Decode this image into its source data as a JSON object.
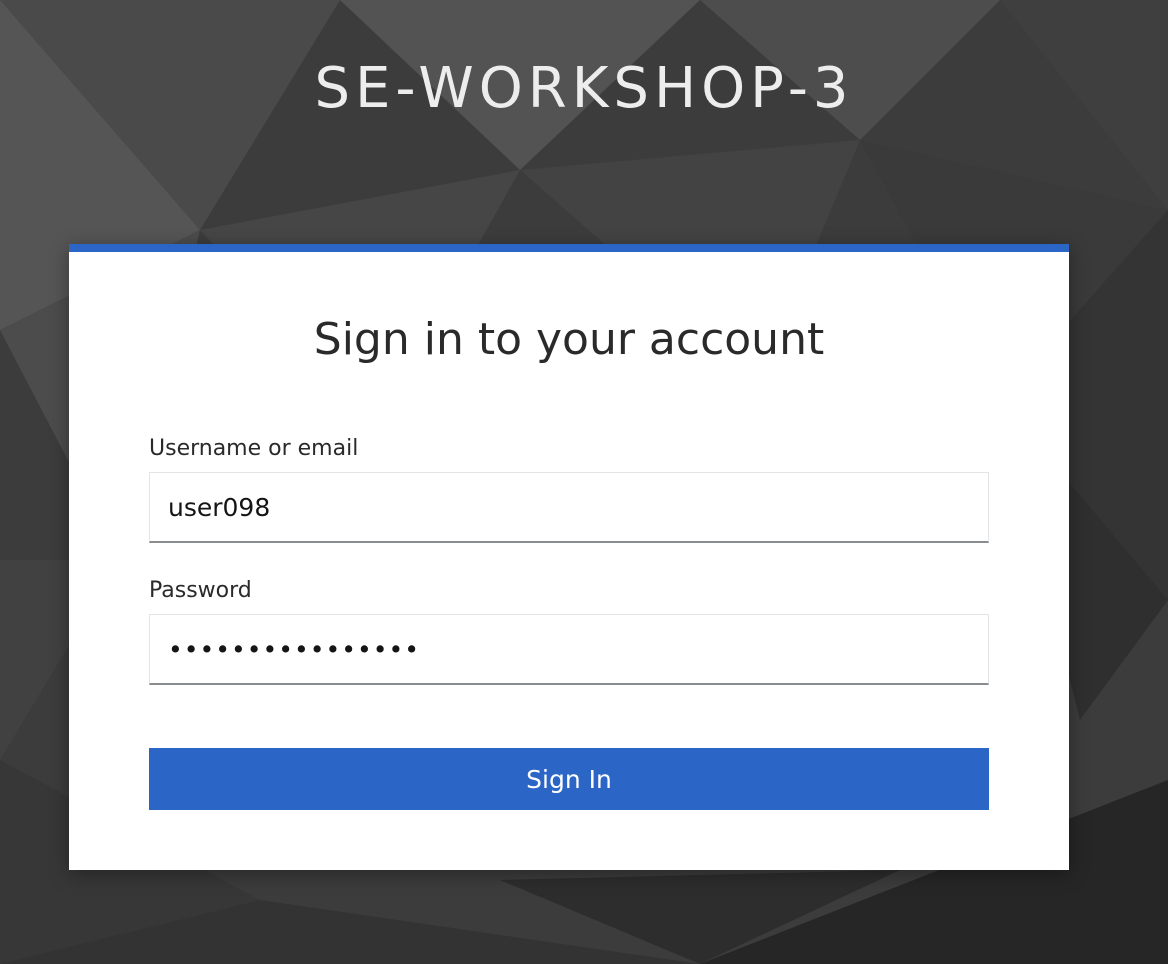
{
  "realm": {
    "title": "SE-WORKSHOP-3"
  },
  "login": {
    "heading": "Sign in to your account",
    "username_label": "Username or email",
    "username_value": "user098",
    "password_label": "Password",
    "password_value": "••••••••••••••••",
    "submit_label": "Sign In"
  },
  "colors": {
    "accent": "#2b65c6",
    "background": "#3c3c3c",
    "card": "#ffffff"
  }
}
